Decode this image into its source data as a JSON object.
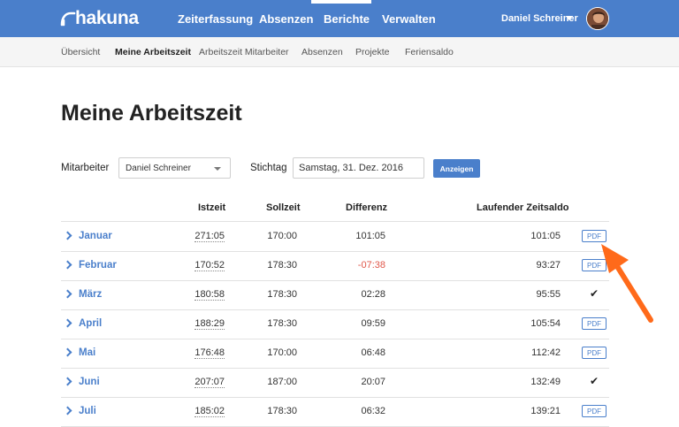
{
  "brand": {
    "name": "hakuna",
    "accent": "#4a7fcb",
    "arrow_color": "#ff6a1a"
  },
  "topnav": {
    "items": [
      "Zeiterfassung",
      "Absenzen",
      "Berichte",
      "Verwalten"
    ],
    "active": "Berichte"
  },
  "user": {
    "name": "Daniel Schreiner"
  },
  "subnav": {
    "items": [
      "Übersicht",
      "Meine Arbeitszeit",
      "Arbeitszeit Mitarbeiter",
      "Absenzen",
      "Projekte",
      "Feriensaldo"
    ],
    "active": "Meine Arbeitszeit"
  },
  "page": {
    "title": "Meine Arbeitszeit"
  },
  "filters": {
    "employee_label": "Mitarbeiter",
    "employee_value": "Daniel Schreiner",
    "date_label": "Stichtag",
    "date_value": "Samstag, 31. Dez. 2016",
    "show_button": "Anzeigen"
  },
  "table": {
    "headers": [
      "Istzeit",
      "Sollzeit",
      "Differenz",
      "Laufender Zeitsaldo"
    ],
    "rows": [
      {
        "month": "Januar",
        "ist": "271:05",
        "soll": "170:00",
        "diff": "101:05",
        "saldo": "101:05",
        "action": "PDF"
      },
      {
        "month": "Februar",
        "ist": "170:52",
        "soll": "178:30",
        "diff": "-07:38",
        "saldo": "93:27",
        "action": "PDF"
      },
      {
        "month": "März",
        "ist": "180:58",
        "soll": "178:30",
        "diff": "02:28",
        "saldo": "95:55",
        "action": "check"
      },
      {
        "month": "April",
        "ist": "188:29",
        "soll": "178:30",
        "diff": "09:59",
        "saldo": "105:54",
        "action": "PDF"
      },
      {
        "month": "Mai",
        "ist": "176:48",
        "soll": "170:00",
        "diff": "06:48",
        "saldo": "112:42",
        "action": "PDF"
      },
      {
        "month": "Juni",
        "ist": "207:07",
        "soll": "187:00",
        "diff": "20:07",
        "saldo": "132:49",
        "action": "check"
      },
      {
        "month": "Juli",
        "ist": "185:02",
        "soll": "178:30",
        "diff": "06:32",
        "saldo": "139:21",
        "action": "PDF"
      }
    ]
  }
}
